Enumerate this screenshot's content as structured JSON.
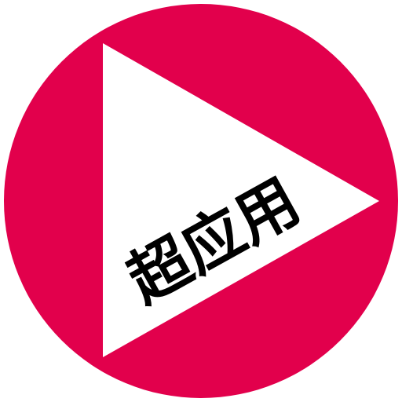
{
  "logo": {
    "text": "超应用",
    "circle_color": "#E2004C",
    "triangle_color": "#FFFFFF",
    "text_color": "#000000"
  },
  "icons": {
    "main": "play-icon"
  }
}
